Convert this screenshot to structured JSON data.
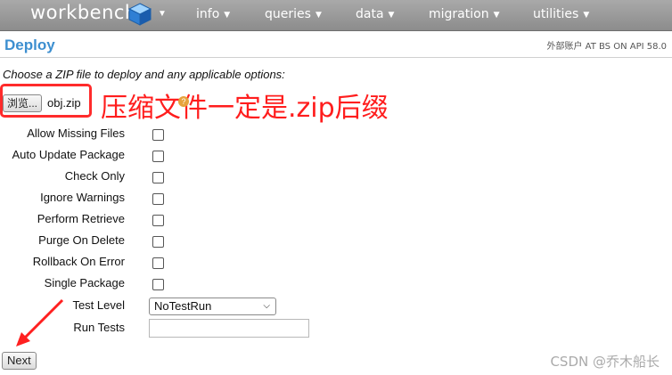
{
  "nav": {
    "logo": "workbench",
    "items": [
      {
        "label": "info"
      },
      {
        "label": "queries"
      },
      {
        "label": "data"
      },
      {
        "label": "migration"
      },
      {
        "label": "utilities"
      }
    ]
  },
  "header": {
    "title": "Deploy",
    "user_info": "外部账户 AT BS ON API 58.0"
  },
  "form": {
    "instructions": "Choose a ZIP file to deploy and any applicable options:",
    "browse_label": "浏览...",
    "file_name": "obj.zip",
    "options": [
      {
        "label": "Allow Missing Files",
        "checked": false
      },
      {
        "label": "Auto Update Package",
        "checked": false
      },
      {
        "label": "Check Only",
        "checked": false
      },
      {
        "label": "Ignore Warnings",
        "checked": false
      },
      {
        "label": "Perform Retrieve",
        "checked": false
      },
      {
        "label": "Purge On Delete",
        "checked": false
      },
      {
        "label": "Rollback On Error",
        "checked": false
      },
      {
        "label": "Single Package",
        "checked": false
      }
    ],
    "test_level_label": "Test Level",
    "test_level_value": "NoTestRun",
    "run_tests_label": "Run Tests",
    "run_tests_value": "",
    "next_label": "Next"
  },
  "annotation": {
    "text": "压缩文件一定是.zip后缀",
    "color": "#ff1d1d"
  },
  "watermark": "CSDN @乔木船长",
  "colors": {
    "nav_bg": "#999999",
    "title": "#3d8fd0",
    "highlight": "#ff2b2b"
  }
}
